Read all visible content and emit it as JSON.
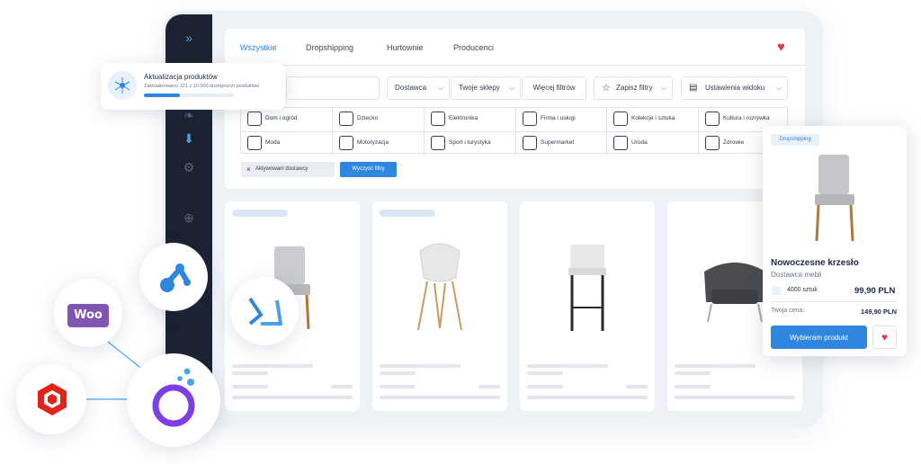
{
  "tabs": [
    "Wszystkie",
    "Dropshipping",
    "Hurtownie",
    "Producenci"
  ],
  "filters": {
    "dostawca": "Dostawca",
    "sklepy": "Twoje sklepy",
    "wiecej": "Więcej filtrów",
    "zapisz": "Zapisz filtry",
    "widok": "Ustawienia widoku"
  },
  "categories": [
    "Dom i ogród",
    "Dziecko",
    "Elektronika",
    "Firma i usługi",
    "Kolekcje i sztuka",
    "Kultura i rozrywka",
    "Moda",
    "Motoryzacja",
    "Sport i turystyka",
    "Supermarket",
    "Uroda",
    "Zdrowie"
  ],
  "chip_label": "Aktywowani dostawcy",
  "clear_label": "Wyczyść filtry",
  "notification": {
    "title": "Aktualizacja produktów",
    "subtitle": "Zaktualizowano 121 z 10.000 dostępnych produktów",
    "progress": 0.4
  },
  "product": {
    "badge": "Dropshipping",
    "name": "Nowoczesne krzesło",
    "supplier": "Dostawca mebli",
    "stock": "4000 sztuk",
    "price": "99,90 PLN",
    "your_price_label": "Twoja cena:",
    "your_price": "149,90 PLN",
    "button": "Wybieram produkt"
  },
  "integrations": {
    "woo": "Woo"
  },
  "colors": {
    "accent": "#2e86de",
    "heart": "#e23a4b",
    "sidebar": "#1b2232"
  }
}
